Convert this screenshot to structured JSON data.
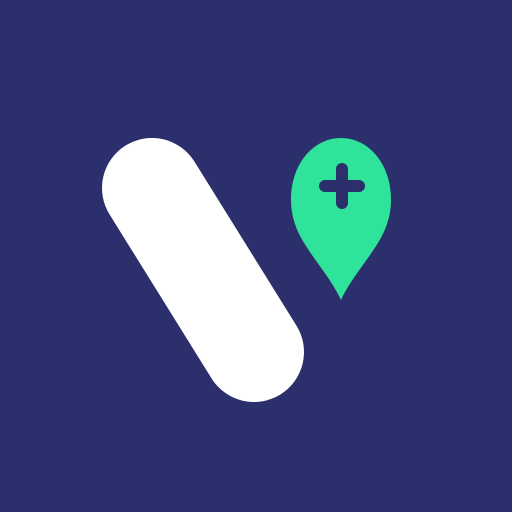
{
  "icon": {
    "name": "v-location-plus-logo",
    "colors": {
      "background": "#2b2f6b",
      "stroke_mark": "#ffffff",
      "pin": "#2fe39a",
      "plus": "#2b2f6b"
    }
  }
}
